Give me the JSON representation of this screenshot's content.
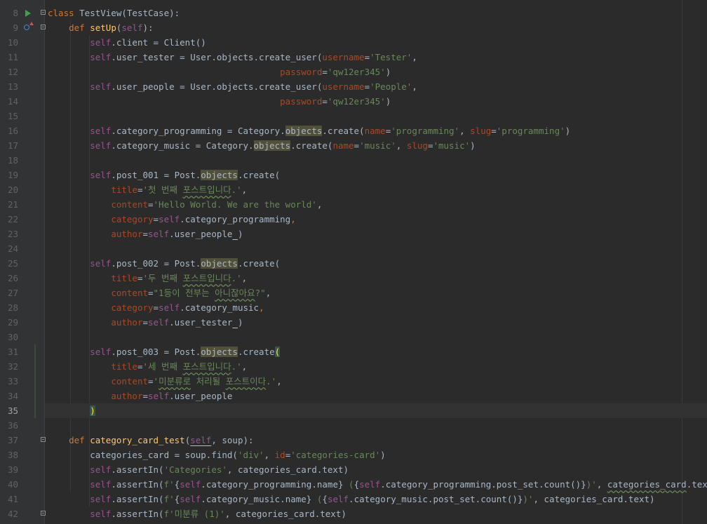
{
  "editor": {
    "current_line": "35",
    "lines": [
      {
        "n": "8",
        "tokens": [
          {
            "t": "class ",
            "c": "kw"
          },
          {
            "t": "TestView",
            "c": "cls"
          },
          {
            "t": "(TestCase):"
          }
        ]
      },
      {
        "n": "9",
        "tokens": [
          {
            "t": "    "
          },
          {
            "t": "def ",
            "c": "kw"
          },
          {
            "t": "setUp",
            "c": "fn"
          },
          {
            "t": "("
          },
          {
            "t": "self",
            "c": "self"
          },
          {
            "t": "):"
          }
        ]
      },
      {
        "n": "10",
        "tokens": [
          {
            "t": "        "
          },
          {
            "t": "self",
            "c": "self"
          },
          {
            "t": ".client = Client()"
          }
        ]
      },
      {
        "n": "11",
        "tokens": [
          {
            "t": "        "
          },
          {
            "t": "self",
            "c": "self"
          },
          {
            "t": ".user_tester = User.objects.create_user("
          },
          {
            "t": "username",
            "c": "param"
          },
          {
            "t": "="
          },
          {
            "t": "'Tester'",
            "c": "str"
          },
          {
            "t": ","
          }
        ]
      },
      {
        "n": "12",
        "tokens": [
          {
            "t": "                                            "
          },
          {
            "t": "password",
            "c": "param"
          },
          {
            "t": "="
          },
          {
            "t": "'qw12er345'",
            "c": "str"
          },
          {
            "t": ")"
          }
        ]
      },
      {
        "n": "13",
        "tokens": [
          {
            "t": "        "
          },
          {
            "t": "self",
            "c": "self"
          },
          {
            "t": ".user_people = User.objects.create_user("
          },
          {
            "t": "username",
            "c": "param"
          },
          {
            "t": "="
          },
          {
            "t": "'People'",
            "c": "str"
          },
          {
            "t": ","
          }
        ]
      },
      {
        "n": "14",
        "tokens": [
          {
            "t": "                                            "
          },
          {
            "t": "password",
            "c": "param"
          },
          {
            "t": "="
          },
          {
            "t": "'qw12er345'",
            "c": "str"
          },
          {
            "t": ")"
          }
        ]
      },
      {
        "n": "15",
        "tokens": []
      },
      {
        "n": "16",
        "tokens": [
          {
            "t": "        "
          },
          {
            "t": "self",
            "c": "self"
          },
          {
            "t": ".category_programming = Category."
          },
          {
            "t": "objects",
            "c": "hl"
          },
          {
            "t": ".create("
          },
          {
            "t": "name",
            "c": "param"
          },
          {
            "t": "="
          },
          {
            "t": "'programming'",
            "c": "str"
          },
          {
            "t": ", "
          },
          {
            "t": "slug",
            "c": "param"
          },
          {
            "t": "="
          },
          {
            "t": "'programming'",
            "c": "str"
          },
          {
            "t": ")"
          }
        ]
      },
      {
        "n": "17",
        "tokens": [
          {
            "t": "        "
          },
          {
            "t": "self",
            "c": "self"
          },
          {
            "t": ".category_music = Category."
          },
          {
            "t": "objects",
            "c": "hl"
          },
          {
            "t": ".create("
          },
          {
            "t": "name",
            "c": "param"
          },
          {
            "t": "="
          },
          {
            "t": "'music'",
            "c": "str"
          },
          {
            "t": ", "
          },
          {
            "t": "slug",
            "c": "param"
          },
          {
            "t": "="
          },
          {
            "t": "'music'",
            "c": "str"
          },
          {
            "t": ")"
          }
        ]
      },
      {
        "n": "18",
        "tokens": []
      },
      {
        "n": "19",
        "tokens": [
          {
            "t": "        "
          },
          {
            "t": "self",
            "c": "self"
          },
          {
            "t": ".post_001 = Post."
          },
          {
            "t": "objects",
            "c": "hl"
          },
          {
            "t": ".create("
          }
        ]
      },
      {
        "n": "20",
        "tokens": [
          {
            "t": "            "
          },
          {
            "t": "title",
            "c": "param"
          },
          {
            "t": "="
          },
          {
            "t": "'첫 번째 ",
            "c": "str"
          },
          {
            "t": "포스트입니다",
            "c": "str typo"
          },
          {
            "t": ".'",
            "c": "str"
          },
          {
            "t": ","
          }
        ]
      },
      {
        "n": "21",
        "tokens": [
          {
            "t": "            "
          },
          {
            "t": "content",
            "c": "param"
          },
          {
            "t": "="
          },
          {
            "t": "'Hello World. We are the world'",
            "c": "str"
          },
          {
            "t": ","
          }
        ]
      },
      {
        "n": "22",
        "tokens": [
          {
            "t": "            "
          },
          {
            "t": "category",
            "c": "param"
          },
          {
            "t": "="
          },
          {
            "t": "self",
            "c": "self"
          },
          {
            "t": ".category_programming"
          },
          {
            "t": ",",
            "c": "kw"
          }
        ]
      },
      {
        "n": "23",
        "tokens": [
          {
            "t": "            "
          },
          {
            "t": "author",
            "c": "param"
          },
          {
            "t": "="
          },
          {
            "t": "self",
            "c": "self"
          },
          {
            "t": ".user_people"
          },
          {
            "t": " ",
            "c": "uline"
          },
          {
            "t": ")"
          }
        ]
      },
      {
        "n": "24",
        "tokens": []
      },
      {
        "n": "25",
        "tokens": [
          {
            "t": "        "
          },
          {
            "t": "self",
            "c": "self"
          },
          {
            "t": ".post_002 = Post."
          },
          {
            "t": "objects",
            "c": "hl"
          },
          {
            "t": ".create("
          }
        ]
      },
      {
        "n": "26",
        "tokens": [
          {
            "t": "            "
          },
          {
            "t": "title",
            "c": "param"
          },
          {
            "t": "="
          },
          {
            "t": "'두 번째 ",
            "c": "str"
          },
          {
            "t": "포스트입니다",
            "c": "str typo"
          },
          {
            "t": ".'",
            "c": "str"
          },
          {
            "t": ","
          }
        ]
      },
      {
        "n": "27",
        "tokens": [
          {
            "t": "            "
          },
          {
            "t": "content",
            "c": "param"
          },
          {
            "t": "="
          },
          {
            "t": "\"1등이 전부는 ",
            "c": "str"
          },
          {
            "t": "아니잖아요",
            "c": "str typo"
          },
          {
            "t": "?\"",
            "c": "str"
          },
          {
            "t": ","
          }
        ]
      },
      {
        "n": "28",
        "tokens": [
          {
            "t": "            "
          },
          {
            "t": "category",
            "c": "param"
          },
          {
            "t": "="
          },
          {
            "t": "self",
            "c": "self"
          },
          {
            "t": ".category_music"
          },
          {
            "t": ",",
            "c": "kw"
          }
        ]
      },
      {
        "n": "29",
        "tokens": [
          {
            "t": "            "
          },
          {
            "t": "author",
            "c": "param"
          },
          {
            "t": "="
          },
          {
            "t": "self",
            "c": "self"
          },
          {
            "t": ".user_tester"
          },
          {
            "t": " ",
            "c": "uline"
          },
          {
            "t": ")"
          }
        ]
      },
      {
        "n": "30",
        "tokens": []
      },
      {
        "n": "31",
        "tokens": [
          {
            "t": "        "
          },
          {
            "t": "self",
            "c": "self"
          },
          {
            "t": ".post_003 = Post."
          },
          {
            "t": "objects",
            "c": "hl"
          },
          {
            "t": ".create"
          },
          {
            "t": "(",
            "c": "brace"
          }
        ]
      },
      {
        "n": "32",
        "tokens": [
          {
            "t": "            "
          },
          {
            "t": "title",
            "c": "param"
          },
          {
            "t": "="
          },
          {
            "t": "'세 번째 ",
            "c": "str"
          },
          {
            "t": "포스트입니다",
            "c": "str typo"
          },
          {
            "t": ".'",
            "c": "str"
          },
          {
            "t": ","
          }
        ]
      },
      {
        "n": "33",
        "tokens": [
          {
            "t": "            "
          },
          {
            "t": "content",
            "c": "param"
          },
          {
            "t": "="
          },
          {
            "t": "'",
            "c": "str"
          },
          {
            "t": "미분류로",
            "c": "str typo"
          },
          {
            "t": " 처리될 ",
            "c": "str"
          },
          {
            "t": "포스트이다",
            "c": "str typo"
          },
          {
            "t": ".'",
            "c": "str"
          },
          {
            "t": ","
          }
        ]
      },
      {
        "n": "34",
        "tokens": [
          {
            "t": "            "
          },
          {
            "t": "author",
            "c": "param"
          },
          {
            "t": "="
          },
          {
            "t": "self",
            "c": "self"
          },
          {
            "t": ".user_people"
          }
        ]
      },
      {
        "n": "35",
        "tokens": [
          {
            "t": "        "
          },
          {
            "t": ")",
            "c": "brace"
          }
        ]
      },
      {
        "n": "36",
        "tokens": []
      },
      {
        "n": "37",
        "tokens": [
          {
            "t": "    "
          },
          {
            "t": "def ",
            "c": "kw"
          },
          {
            "t": "category_card_test",
            "c": "fn"
          },
          {
            "t": "("
          },
          {
            "t": "self",
            "c": "self uline"
          },
          {
            "t": ", soup):"
          }
        ]
      },
      {
        "n": "38",
        "tokens": [
          {
            "t": "        categories_card = soup.find("
          },
          {
            "t": "'div'",
            "c": "str"
          },
          {
            "t": ", "
          },
          {
            "t": "id",
            "c": "param"
          },
          {
            "t": "="
          },
          {
            "t": "'categories-card'",
            "c": "str"
          },
          {
            "t": ")"
          }
        ]
      },
      {
        "n": "39",
        "tokens": [
          {
            "t": "        "
          },
          {
            "t": "self",
            "c": "self"
          },
          {
            "t": ".assertIn("
          },
          {
            "t": "'Categories'",
            "c": "str"
          },
          {
            "t": ", categories_card.text)"
          }
        ]
      },
      {
        "n": "40",
        "tokens": [
          {
            "t": "        "
          },
          {
            "t": "self",
            "c": "self"
          },
          {
            "t": ".assertIn("
          },
          {
            "t": "f'",
            "c": "str"
          },
          {
            "t": "{"
          },
          {
            "t": "self",
            "c": "self"
          },
          {
            "t": ".category_programming.name}"
          },
          {
            "t": " (",
            "c": "str"
          },
          {
            "t": "{"
          },
          {
            "t": "self",
            "c": "self"
          },
          {
            "t": ".category_programming.post_set.count()}"
          },
          {
            "t": ")'",
            "c": "str"
          },
          {
            "t": ", "
          },
          {
            "t": "categories_card",
            "c": "typo"
          },
          {
            "t": ".text)"
          }
        ]
      },
      {
        "n": "41",
        "tokens": [
          {
            "t": "        "
          },
          {
            "t": "self",
            "c": "self"
          },
          {
            "t": ".assertIn("
          },
          {
            "t": "f'",
            "c": "str"
          },
          {
            "t": "{"
          },
          {
            "t": "self",
            "c": "self"
          },
          {
            "t": ".category_music.name}"
          },
          {
            "t": " (",
            "c": "str"
          },
          {
            "t": "{"
          },
          {
            "t": "self",
            "c": "self"
          },
          {
            "t": ".category_music.post_set.count()}"
          },
          {
            "t": ")'",
            "c": "str"
          },
          {
            "t": ", categories_card.text)"
          }
        ]
      },
      {
        "n": "42",
        "tokens": [
          {
            "t": "        "
          },
          {
            "t": "self",
            "c": "self"
          },
          {
            "t": ".assertIn("
          },
          {
            "t": "f'미분류 (1)'",
            "c": "str"
          },
          {
            "t": ", categories_card.text)"
          }
        ]
      }
    ]
  }
}
